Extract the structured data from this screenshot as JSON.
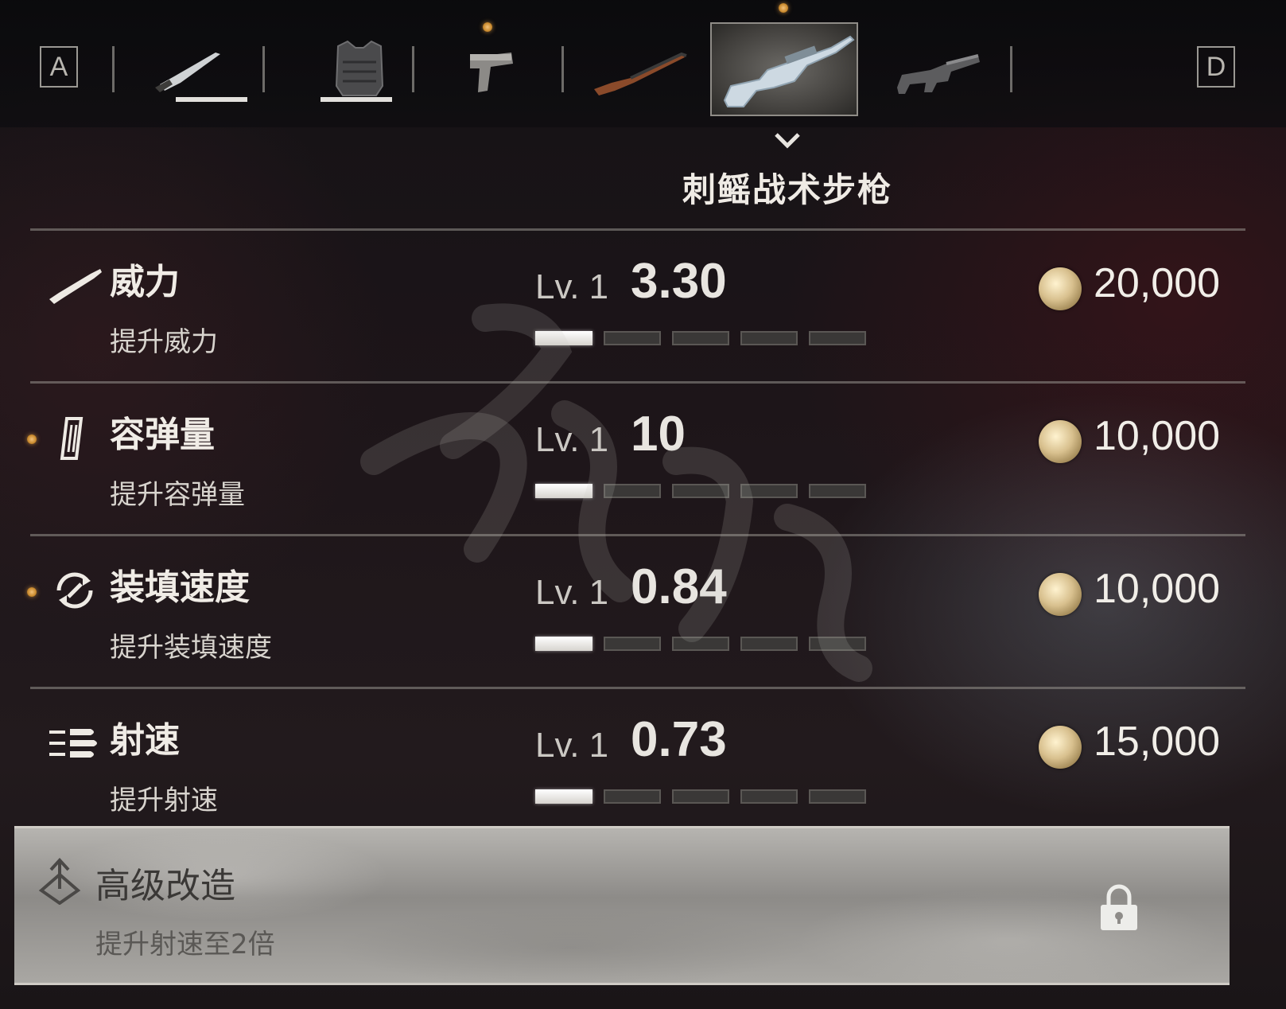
{
  "tabs": {
    "left_key": "A",
    "right_key": "D",
    "items": [
      {
        "name": "knife",
        "selected": false
      },
      {
        "name": "body-armor",
        "selected": false
      },
      {
        "name": "handgun",
        "selected": false
      },
      {
        "name": "rifle",
        "selected": false
      },
      {
        "name": "tactical-rifle",
        "selected": true
      },
      {
        "name": "assault-rifle",
        "selected": false
      }
    ]
  },
  "weapon": {
    "title": "刺鳐战术步枪"
  },
  "upgrades": [
    {
      "name": "威力",
      "desc": "提升威力",
      "level": "Lv. 1",
      "value": "3.30",
      "price": "20,000",
      "level_filled": 1,
      "level_max": 5,
      "icon": "rifle-icon",
      "new": false
    },
    {
      "name": "容弹量",
      "desc": "提升容弹量",
      "level": "Lv. 1",
      "value": "10",
      "price": "10,000",
      "level_filled": 1,
      "level_max": 5,
      "icon": "magazine-icon",
      "new": true
    },
    {
      "name": "装填速度",
      "desc": "提升装填速度",
      "level": "Lv. 1",
      "value": "0.84",
      "price": "10,000",
      "level_filled": 1,
      "level_max": 5,
      "icon": "reload-icon",
      "new": true
    },
    {
      "name": "射速",
      "desc": "提升射速",
      "level": "Lv. 1",
      "value": "0.73",
      "price": "15,000",
      "level_filled": 1,
      "level_max": 5,
      "icon": "bullets-icon",
      "new": false
    }
  ],
  "advanced": {
    "title": "高级改造",
    "desc": "提升射速至2倍",
    "locked": true
  },
  "colors": {
    "accent_dot": "#e0a040",
    "pip_on": "#f4f2ee",
    "pip_off": "#3a3837"
  }
}
